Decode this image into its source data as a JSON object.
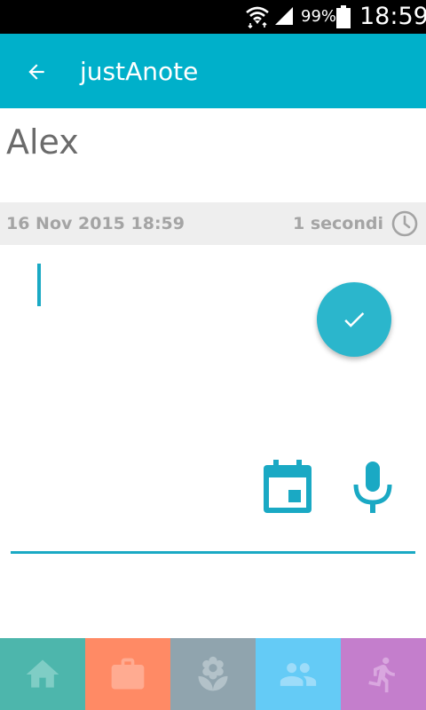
{
  "status_bar": {
    "battery_percent": "99%",
    "time": "18:59"
  },
  "app_bar": {
    "title": "justAnote",
    "back_icon": "arrow-back-icon"
  },
  "note": {
    "title": "Alex",
    "date": "16 Nov 2015 18:59",
    "elapsed": "1 secondi",
    "body": ""
  },
  "actions": {
    "done_icon": "check-icon",
    "calendar_icon": "calendar-icon",
    "mic_icon": "microphone-icon"
  },
  "bottom_nav": {
    "items": [
      {
        "icon": "home-icon",
        "color": "#4db6ac"
      },
      {
        "icon": "briefcase-icon",
        "color": "#ff8a65"
      },
      {
        "icon": "flower-icon",
        "color": "#90a4ae"
      },
      {
        "icon": "people-icon",
        "color": "#64cbf6"
      },
      {
        "icon": "running-person-icon",
        "color": "#c47ecc"
      }
    ]
  },
  "colors": {
    "primary": "#00b0ca",
    "accent": "#2bb6cc",
    "title_text": "#6b6b6b",
    "meta_text": "#a4a4a4",
    "meta_background": "#eeeeee"
  }
}
